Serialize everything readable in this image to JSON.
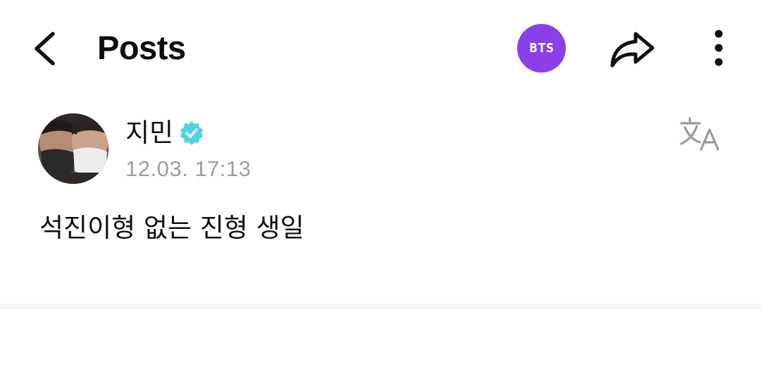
{
  "header": {
    "title": "Posts",
    "back_icon": "chevron-left-icon",
    "artist_badge": "BTS",
    "artist_badge_color": "#8a3fe8",
    "share_icon": "share-arrow-icon",
    "more_icon": "vertical-dots-icon"
  },
  "post": {
    "author": "지민",
    "verified_icon": "verified-badge-icon",
    "verified_color": "#4fd4e4",
    "timestamp": "12.03. 17:13",
    "translate_icon": "translate-icon",
    "body": "석진이형 없는 진형 생일"
  }
}
